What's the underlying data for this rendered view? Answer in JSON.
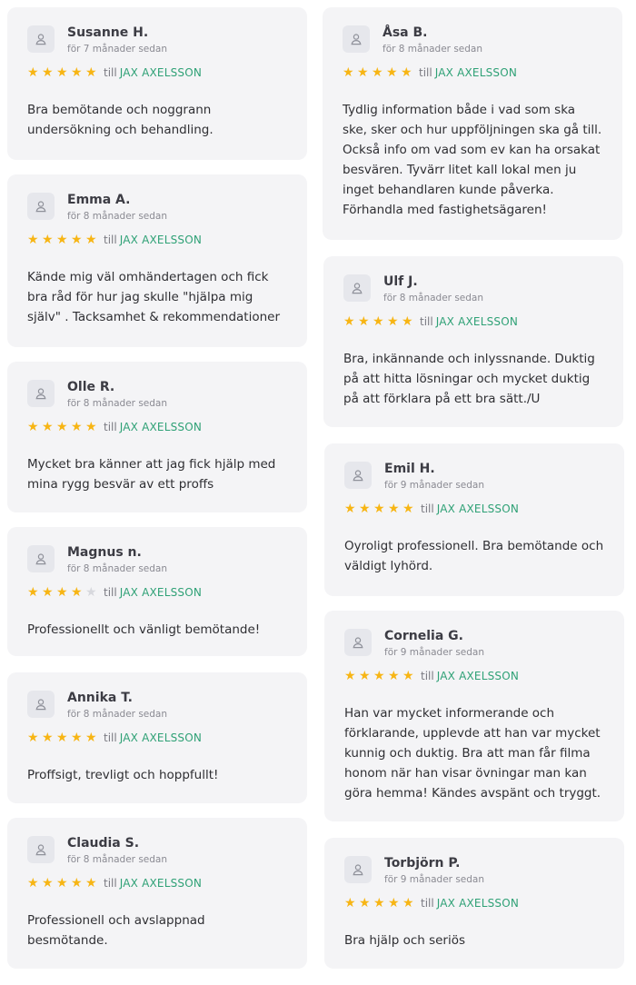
{
  "colors": {
    "star": "#f7b514",
    "star_empty": "#d7d8dd",
    "employee_link": "#2fa176",
    "card_bg": "#f4f4f6"
  },
  "icons": {
    "avatar": "user-icon",
    "star": "star-icon"
  },
  "reviews": [
    {
      "name": "Susanne H.",
      "time": "för 7 månader sedan",
      "rating": 5,
      "prefix": "till",
      "employee": "JAX AXELSSON",
      "text": "Bra bemötande och noggrann undersökning och behandling."
    },
    {
      "name": "Åsa B.",
      "time": "för 8 månader sedan",
      "rating": 5,
      "prefix": "till",
      "employee": "JAX AXELSSON",
      "text": "Tydlig information både i vad som ska ske, sker och hur uppföljningen ska gå till. Också info om vad som ev kan ha orsakat besvären. Tyvärr litet kall lokal men ju inget behandlaren kunde påverka. Förhandla med fastighetsägaren!"
    },
    {
      "name": "Emma A.",
      "time": "för 8 månader sedan",
      "rating": 5,
      "prefix": "till",
      "employee": "JAX AXELSSON",
      "text": "Kände mig väl omhändertagen och fick bra råd för hur jag skulle \"hjälpa mig själv\" . Tacksamhet & rekommendationer"
    },
    {
      "name": "Ulf J.",
      "time": "för 8 månader sedan",
      "rating": 5,
      "prefix": "till",
      "employee": "JAX AXELSSON",
      "text": "Bra, inkännande och inlyssnande. Duktig på att hitta lösningar och mycket duktig på att förklara på ett bra sätt./U"
    },
    {
      "name": "Olle R.",
      "time": "för 8 månader sedan",
      "rating": 5,
      "prefix": "till",
      "employee": "JAX AXELSSON",
      "text": "Mycket bra känner att jag fick hjälp med mina rygg besvär av ett proffs"
    },
    {
      "name": "Emil H.",
      "time": "för 9 månader sedan",
      "rating": 5,
      "prefix": "till",
      "employee": "JAX AXELSSON",
      "text": "Oyroligt professionell. Bra bemötande och väldigt lyhörd."
    },
    {
      "name": "Magnus n.",
      "time": "för 8 månader sedan",
      "rating": 4,
      "prefix": "till",
      "employee": "JAX AXELSSON",
      "text": "Professionellt och vänligt bemötande!"
    },
    {
      "name": "Cornelia G.",
      "time": "för 9 månader sedan",
      "rating": 5,
      "prefix": "till",
      "employee": "JAX AXELSSON",
      "text": "Han var mycket informerande och förklarande, upplevde att han var mycket kunnig och duktig. Bra att man får filma honom när han visar övningar man kan göra hemma! Kändes avspänt och tryggt."
    },
    {
      "name": "Annika T.",
      "time": "för 8 månader sedan",
      "rating": 5,
      "prefix": "till",
      "employee": "JAX AXELSSON",
      "text": "Proffsigt, trevligt och hoppfullt!"
    },
    {
      "name": "Torbjörn P.",
      "time": "för 9 månader sedan",
      "rating": 5,
      "prefix": "till",
      "employee": "JAX AXELSSON",
      "text": "Bra hjälp och seriös"
    },
    {
      "name": "Claudia S.",
      "time": "för 8 månader sedan",
      "rating": 5,
      "prefix": "till",
      "employee": "JAX AXELSSON",
      "text": "Professionell och avslappnad besmötande."
    }
  ]
}
